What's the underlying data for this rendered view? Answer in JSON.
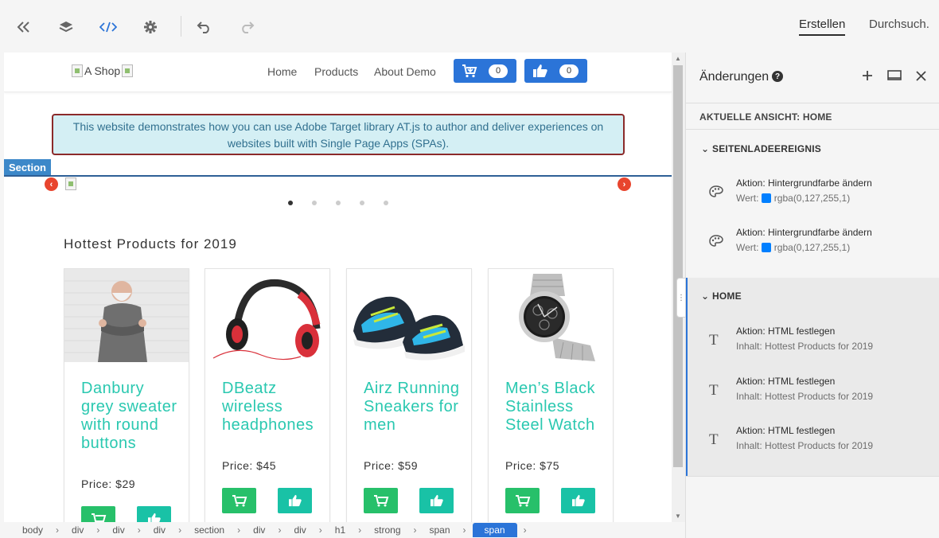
{
  "toolbar": {
    "tabs": [
      {
        "label": "Erstellen",
        "active": true
      },
      {
        "label": "Durchsuch.",
        "active": false
      }
    ]
  },
  "site": {
    "logo_alt": "A Shop",
    "nav": [
      "Home",
      "Products",
      "About Demo"
    ],
    "cart_count": "0",
    "like_count": "0",
    "info_text_line1": "This website demonstrates how you can use Adobe Target library AT.js to author and deliver experiences on",
    "info_text_line2": "websites built with Single Page Apps (SPAs).",
    "section_label": "Section",
    "hottest_title": "Hottest Products for 2019",
    "products": [
      {
        "name": "Danbury grey sweater with round buttons",
        "price": "Price: $29"
      },
      {
        "name": "DBeatz wireless headphones",
        "price": "Price: $45"
      },
      {
        "name": "Airz Running Sneakers for men",
        "price": "Price: $59"
      },
      {
        "name": "Men’s Black Stainless Steel Watch",
        "price": "Price: $75"
      }
    ]
  },
  "breadcrumb": [
    "body",
    "div",
    "div",
    "div",
    "section",
    "div",
    "div",
    "h1",
    "strong",
    "span",
    "span"
  ],
  "panel": {
    "title": "Änderungen",
    "help_glyph": "?",
    "view_label_prefix": "AKTUELLE ANSICHT: ",
    "view_label_name": "HOME",
    "groups": [
      {
        "name": "SEITENLADEEREIGNIS",
        "items": [
          {
            "title": "Aktion: Hintergrundfarbe ändern",
            "sub_prefix": "Wert:",
            "value": "rgba(0,127,255,1)"
          },
          {
            "title": "Aktion: Hintergrundfarbe ändern",
            "sub_prefix": "Wert:",
            "value": "rgba(0,127,255,1)"
          }
        ]
      },
      {
        "name": "HOME",
        "items": [
          {
            "title": "Aktion: HTML festlegen",
            "sub": "Inhalt: Hottest Products for 2019"
          },
          {
            "title": "Aktion: HTML festlegen",
            "sub": "Inhalt: Hottest Products for 2019"
          },
          {
            "title": "Aktion: HTML festlegen",
            "sub": "Inhalt: Hottest Products for 2019"
          }
        ]
      }
    ],
    "swatch_color": "#007fff"
  },
  "colors": {
    "accent_blue": "#2b74d8",
    "product_teal": "#2ac8b0",
    "cart_green": "#27c06a",
    "like_teal": "#19c2a6",
    "carousel_arrow": "#e8452e"
  }
}
